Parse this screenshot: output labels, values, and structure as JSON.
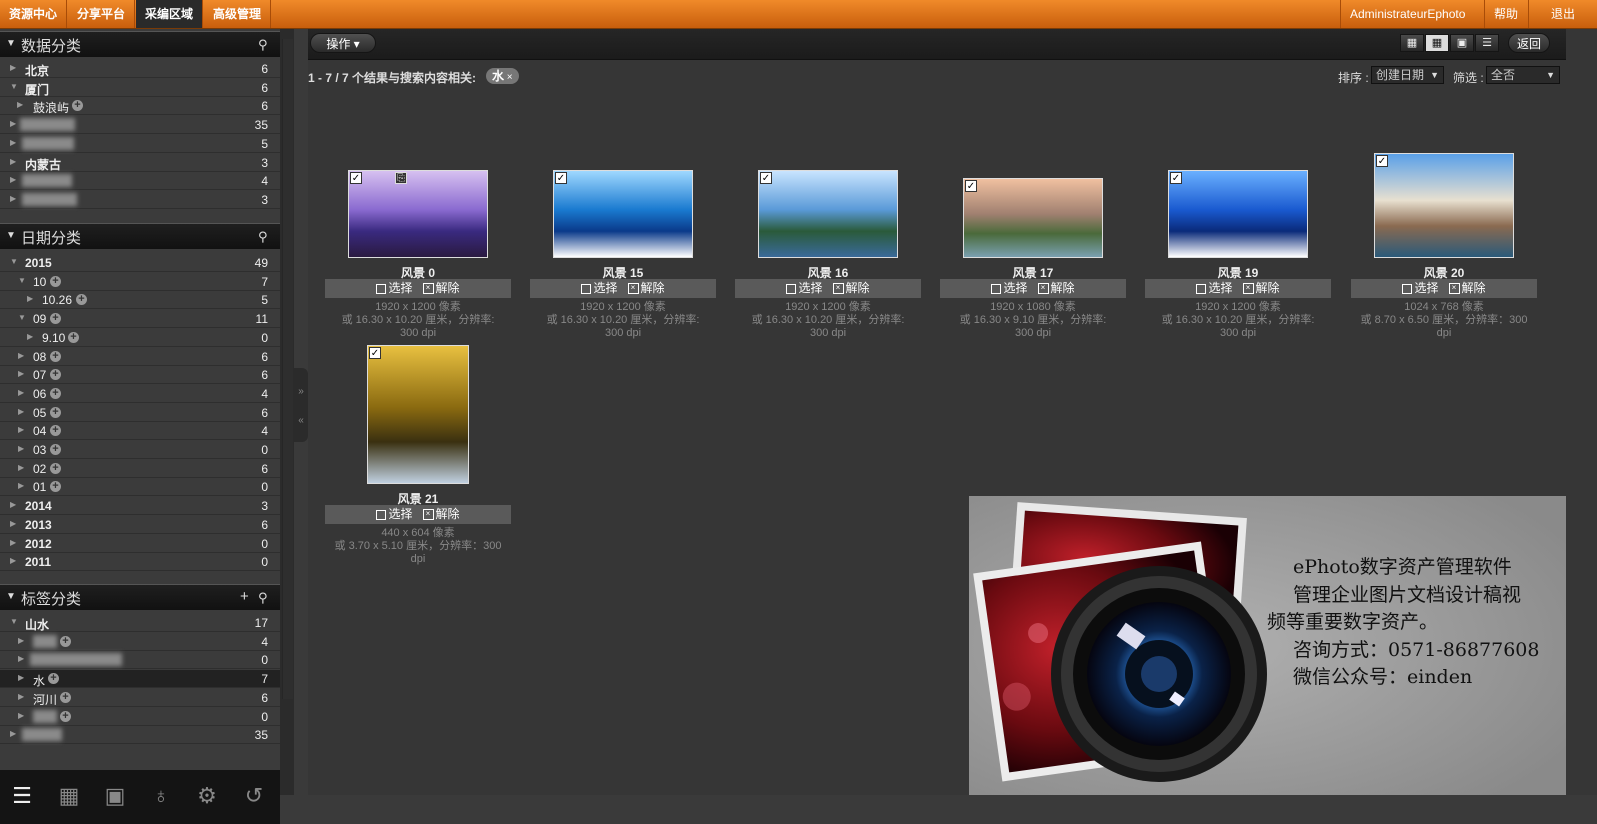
{
  "topnav": {
    "tabs": [
      "资源中心",
      "分享平台",
      "采编区域",
      "高级管理"
    ],
    "active_tab": "采编区域",
    "user": "AdministrateurEphoto",
    "help": "帮助",
    "logout": "退出"
  },
  "sidebar": {
    "data_section": {
      "title": "数据分类",
      "items": [
        {
          "label": "北京",
          "count": "6"
        },
        {
          "label": "厦门",
          "count": "6"
        },
        {
          "label": "鼓浪屿",
          "count": "6"
        },
        {
          "label": "",
          "count": "35"
        },
        {
          "label": "",
          "count": "5"
        },
        {
          "label": "内蒙古",
          "count": "3"
        },
        {
          "label": "",
          "count": "4"
        },
        {
          "label": "",
          "count": "3"
        }
      ]
    },
    "date_section": {
      "title": "日期分类",
      "items": [
        {
          "label": "2015",
          "count": "49"
        },
        {
          "label": "10",
          "count": "7"
        },
        {
          "label": "10.26",
          "count": "5"
        },
        {
          "label": "09",
          "count": "11"
        },
        {
          "label": "9.10",
          "count": "0"
        },
        {
          "label": "08",
          "count": "6"
        },
        {
          "label": "07",
          "count": "6"
        },
        {
          "label": "06",
          "count": "4"
        },
        {
          "label": "05",
          "count": "6"
        },
        {
          "label": "04",
          "count": "4"
        },
        {
          "label": "03",
          "count": "0"
        },
        {
          "label": "02",
          "count": "6"
        },
        {
          "label": "01",
          "count": "0"
        },
        {
          "label": "2014",
          "count": "3"
        },
        {
          "label": "2013",
          "count": "6"
        },
        {
          "label": "2012",
          "count": "0"
        },
        {
          "label": "2011",
          "count": "0"
        }
      ]
    },
    "tag_section": {
      "title": "标签分类",
      "items": [
        {
          "label": "山水",
          "count": "17"
        },
        {
          "label": "",
          "count": "4"
        },
        {
          "label": "",
          "count": "0"
        },
        {
          "label": "水",
          "count": "7"
        },
        {
          "label": "河川",
          "count": "6"
        },
        {
          "label": "",
          "count": "0"
        },
        {
          "label": "",
          "count": "35"
        }
      ]
    }
  },
  "toolbar": {
    "actions_label": "操作",
    "back_label": "返回"
  },
  "results": {
    "summary": "1 - 7 / 7 个结果与搜索内容相关:",
    "tag": "水"
  },
  "sort": {
    "sort_label": "排序",
    "sort_value": "创建日期",
    "filter_label": "筛选",
    "filter_value": "全否"
  },
  "select_label": "选择",
  "unselect_label": "解除",
  "cards": [
    {
      "name": "风景 0",
      "pixels": "1920 x 1200 像素",
      "size": "或 16.30 x 10.20 厘米，分辨率:",
      "dpi": "300 dpi"
    },
    {
      "name": "风景 15",
      "pixels": "1920 x 1200 像素",
      "size": "或 16.30 x 10.20 厘米，分辨率:",
      "dpi": "300 dpi"
    },
    {
      "name": "风景 16",
      "pixels": "1920 x 1200 像素",
      "size": "或 16.30 x 10.20 厘米，分辨率:",
      "dpi": "300 dpi"
    },
    {
      "name": "风景 17",
      "pixels": "1920 x 1080 像素",
      "size": "或 16.30 x 9.10 厘米，分辨率:",
      "dpi": "300 dpi"
    },
    {
      "name": "风景 19",
      "pixels": "1920 x 1200 像素",
      "size": "或 16.30 x 10.20 厘米，分辨率:",
      "dpi": "300 dpi"
    },
    {
      "name": "风景 20",
      "pixels": "1024 x 768 像素",
      "size": "或 8.70 x 6.50 厘米，分辨率：300",
      "dpi": "dpi"
    },
    {
      "name": "风景 21",
      "pixels": "440 x 604 像素",
      "size": "或 3.70 x 5.10 厘米，分辨率：300",
      "dpi": "dpi"
    }
  ],
  "ad": {
    "line1": "ePhoto数字资产管理软件",
    "line2": "管理企业图片文档设计稿视",
    "line3": "频等重要数字资产。",
    "line4": "咨询方式：0571-86877608",
    "line5": "微信公众号：einden"
  }
}
